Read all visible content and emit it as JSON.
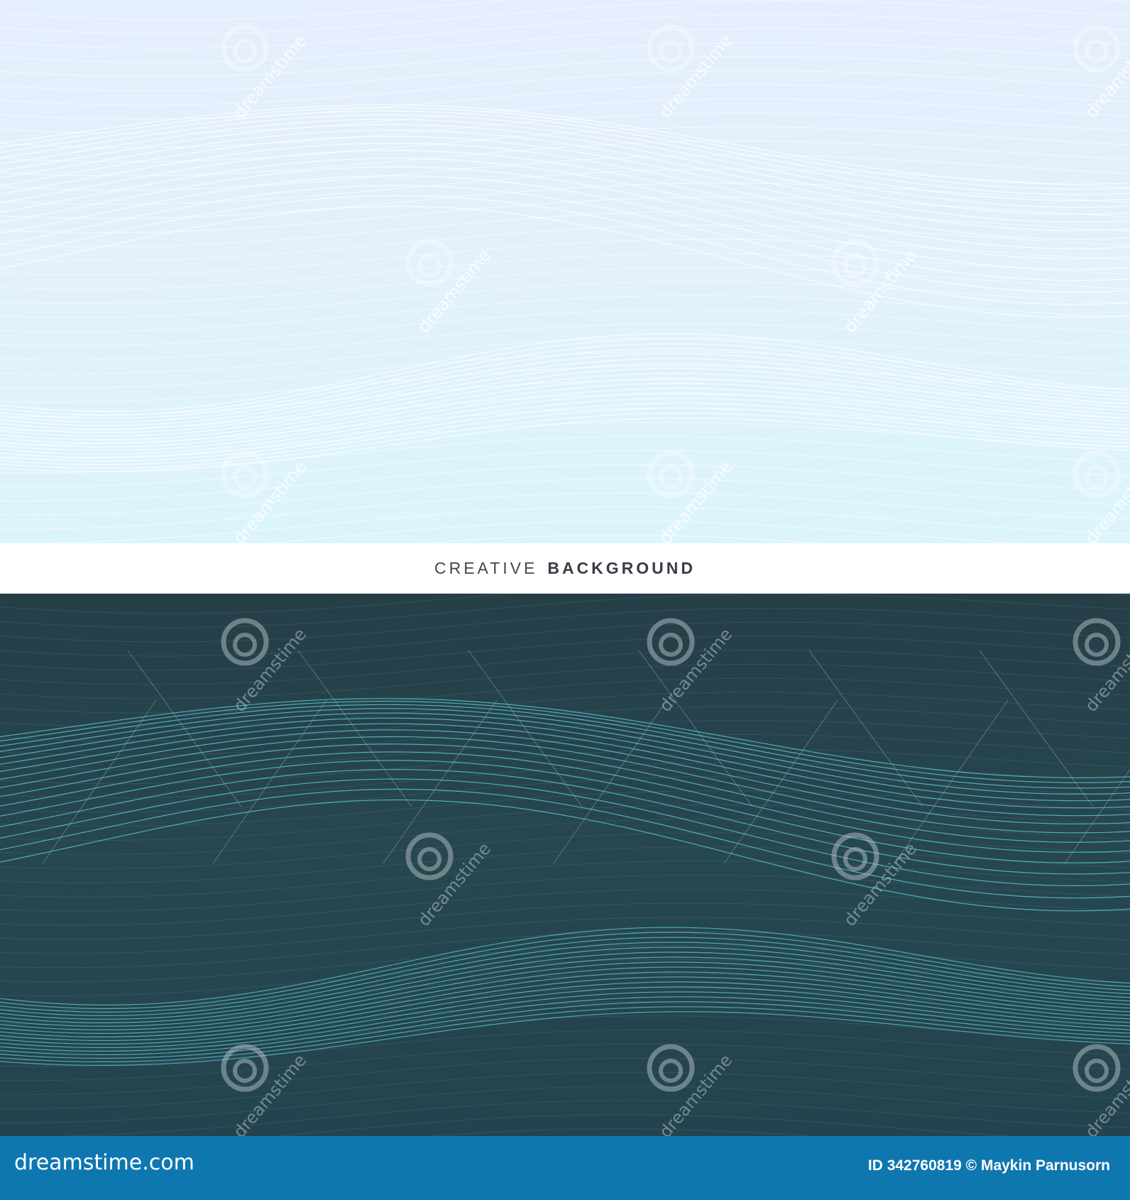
{
  "header": {
    "title_light": "CREATIVE",
    "title_bold": "BACKGROUND"
  },
  "footer": {
    "logo": "dreamstime.com",
    "credit": "ID 342760819 © Maykin Parnusorn"
  },
  "watermark": {
    "text": "dreamstime"
  },
  "colors": {
    "light_bg": "#e2f1fc",
    "dark_bg": "#26434d",
    "dark_wave_line": "#5fd3dc",
    "light_wave_line": "#ffffff",
    "footer_bg": "#0f77b0",
    "title_text": "#3a3c46"
  }
}
